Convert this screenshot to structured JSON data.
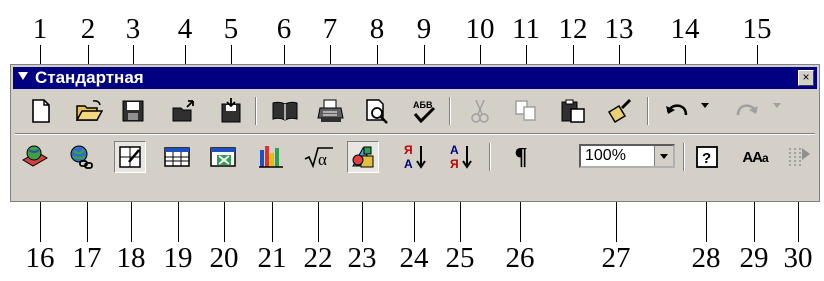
{
  "toolbar": {
    "title": "Стандартная",
    "close_glyph": "×",
    "zoom_value": "100%"
  },
  "callouts_top": [
    "1",
    "2",
    "3",
    "4",
    "5",
    "6",
    "7",
    "8",
    "9",
    "10",
    "11",
    "12",
    "13",
    "14",
    "15"
  ],
  "callouts_bottom": [
    "16",
    "17",
    "18",
    "19",
    "20",
    "21",
    "22",
    "23",
    "24",
    "25",
    "26",
    "27",
    "28",
    "29",
    "30"
  ],
  "icons_row1": [
    "new-document-icon",
    "open-folder-icon",
    "save-disk-icon",
    "email-icon",
    "save-to-disk-icon",
    "book-icon",
    "print-icon",
    "print-preview-icon",
    "spelling-icon",
    "cut-icon",
    "copy-icon",
    "paste-icon",
    "format-painter-icon",
    "undo-icon",
    "redo-icon"
  ],
  "icons_row2": [
    "web-toolbar-icon",
    "insert-hyperlink-icon",
    "tables-borders-icon",
    "insert-table-icon",
    "insert-excel-icon",
    "insert-chart-icon",
    "equation-icon",
    "drawing-icon",
    "sort-ascending-icon",
    "sort-descending-icon",
    "show-paragraph-icon",
    "zoom-combo",
    "help-icon",
    "styles-icon",
    "columns-icon"
  ],
  "glyphs": {
    "sort_top": "Я",
    "sort_mid": "А",
    "pilcrow": "¶",
    "sqrt": "√α",
    "aaa": "AAa",
    "help": "?"
  }
}
